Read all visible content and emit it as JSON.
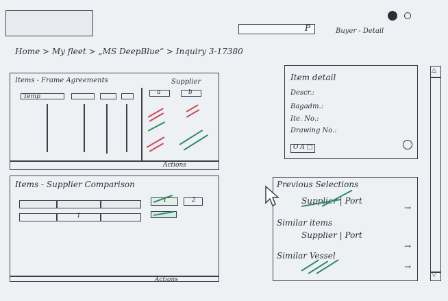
{
  "logo": {
    "text": ""
  },
  "header": {
    "search_button": "P",
    "user_label": "Buyer - Detail"
  },
  "breadcrumb": {
    "text": "Home > My fleet > „MS DeepBlue“ > Inquiry 3-17380"
  },
  "panels": {
    "items_frame": {
      "title": "Items - Frame Agreements",
      "supplier_label": "Supplier",
      "column_headers": [
        "Temp",
        "~~~",
        "~~",
        "~~~"
      ],
      "supplier_headers": [
        "a",
        "b"
      ],
      "actions": "Actions"
    },
    "item_detail": {
      "title": "Item detail",
      "fields": [
        "Descr.:",
        "Bagadm.:",
        "Ite. No.:",
        "Drawing No.:"
      ],
      "button_group_label": "O A □"
    },
    "comparison": {
      "title": "Items - Supplier Comparison",
      "row_labels": [
        "1"
      ],
      "right_buttons": [
        "1",
        "2"
      ],
      "actions": "Actions"
    },
    "sidebar": {
      "previous_selections_title": "Previous Selections",
      "supplier_port": "Supplier | Port",
      "similar_items_title": "Similar items",
      "similar_items_sub": "Supplier | Port",
      "similar_vessel_title": "Similar Vessel",
      "arrow": "→"
    }
  },
  "scrollbar": {
    "up": "△",
    "down": "▽"
  },
  "colors": {
    "ink": "#3a3f4b",
    "red": "#c84b55",
    "green": "#2f8a62",
    "paper": "#eef1f4"
  }
}
